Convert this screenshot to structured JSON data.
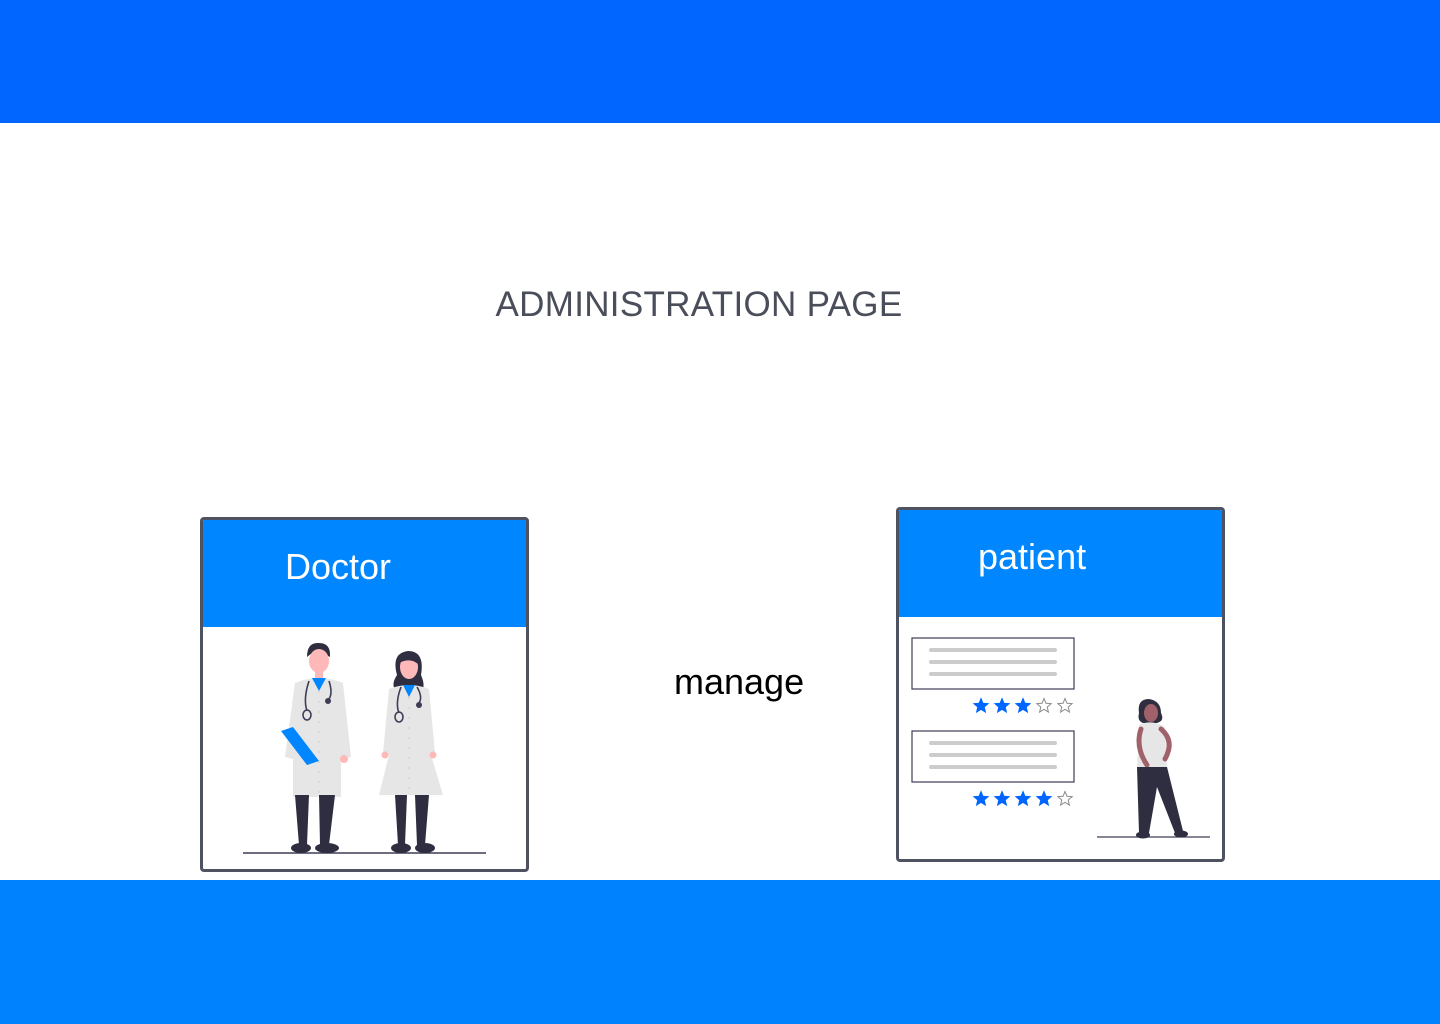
{
  "header": {
    "bar_color": "#0066FF"
  },
  "main": {
    "title": "ADMINISTRATION PAGE",
    "manage_label": "manage",
    "cards": {
      "doctor": {
        "label": "Doctor",
        "header_color": "#0086FF",
        "illustration": "doctors-illustration"
      },
      "patient": {
        "label": "patient",
        "header_color": "#0086FF",
        "illustration": "patient-reviews-illustration",
        "reviews": [
          {
            "stars": 3,
            "max": 5
          },
          {
            "stars": 4,
            "max": 5
          }
        ]
      }
    }
  },
  "footer": {
    "bar_color": "#0082FF"
  }
}
